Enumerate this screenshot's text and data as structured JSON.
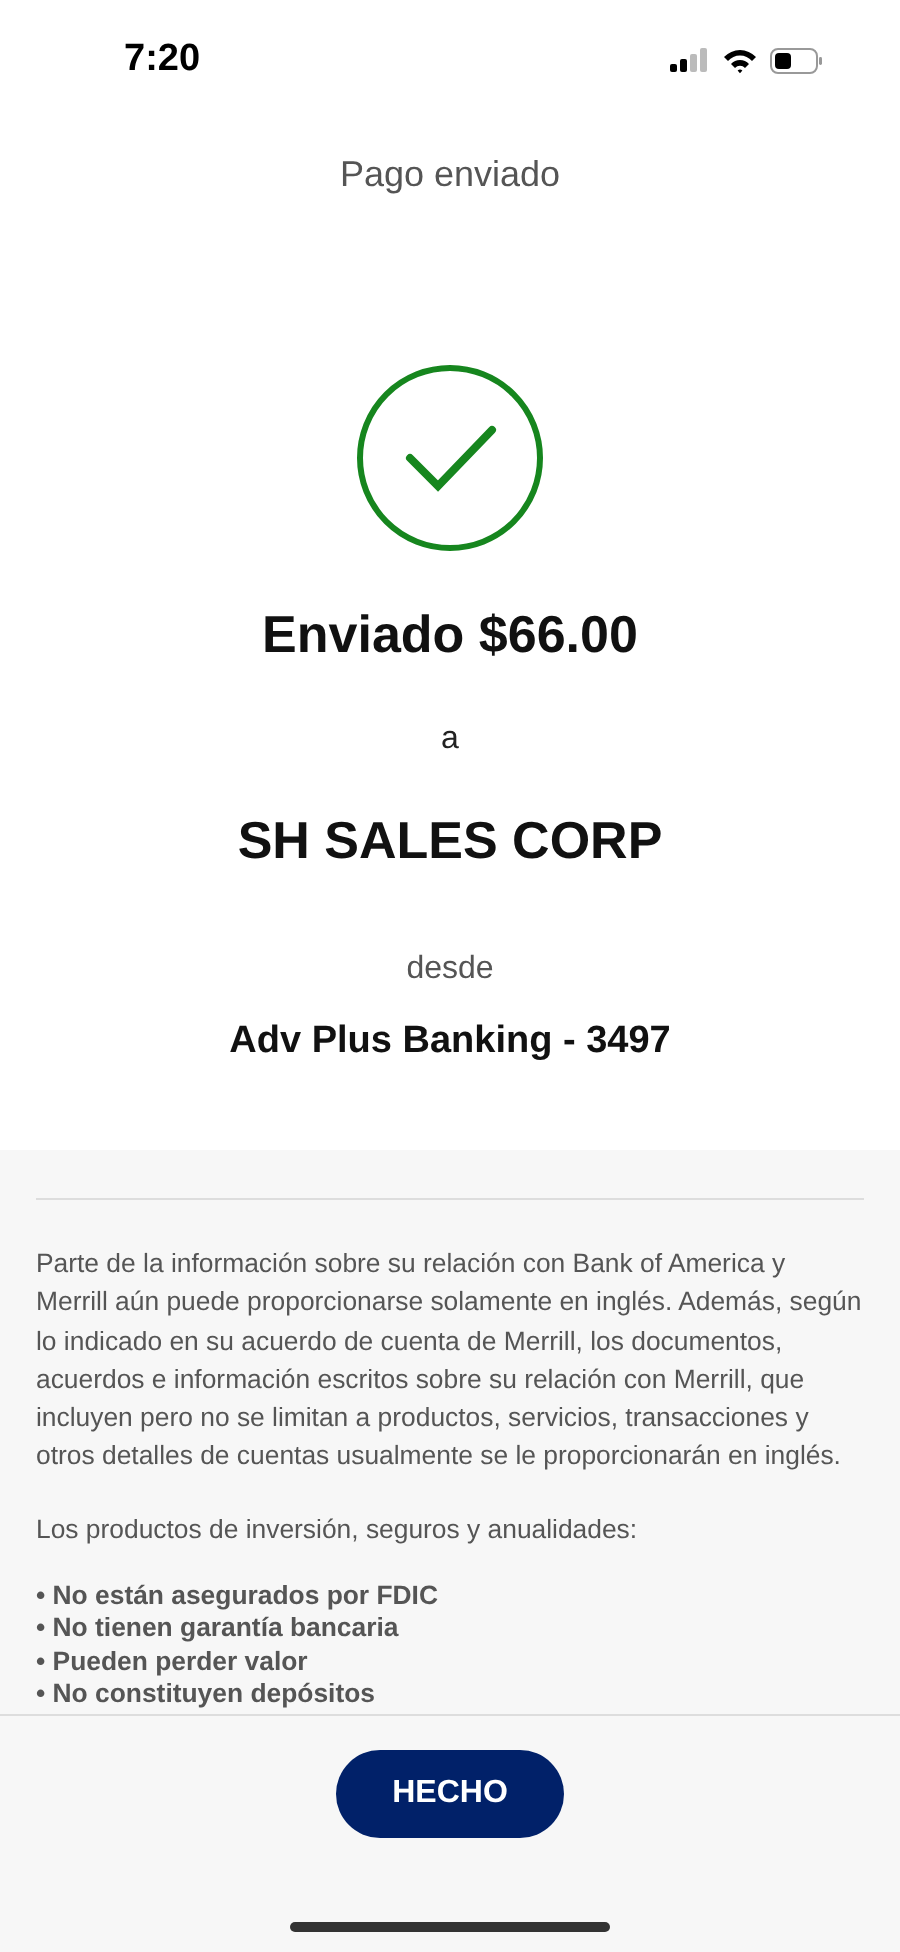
{
  "status_bar": {
    "time": "7:20"
  },
  "header": {
    "title": "Pago enviado"
  },
  "confirmation": {
    "amount_line": "Enviado $66.00",
    "to_label": "a",
    "payee": "SH SALES CORP",
    "from_label": "desde",
    "account": "Adv Plus Banking - 3497"
  },
  "disclosure": {
    "paragraph": "Parte de la información sobre su relación con Bank of America y Merrill aún puede proporcionarse solamente en inglés. Además, según lo indicado en su acuerdo de cuenta de Merrill, los documentos, acuerdos e información escritos sobre su relación con Merrill, que incluyen pero no se limitan a productos, servicios, transacciones y otros detalles de cuentas usualmente se le proporcionarán en inglés.",
    "list_intro": "Los productos de inversión, seguros y anualidades:",
    "items": [
      "• No están asegurados por FDIC",
      "• No tienen garantía bancaria",
      "• Pueden perder valor",
      "• No constituyen depósitos"
    ]
  },
  "footer": {
    "button": "HECHO"
  }
}
